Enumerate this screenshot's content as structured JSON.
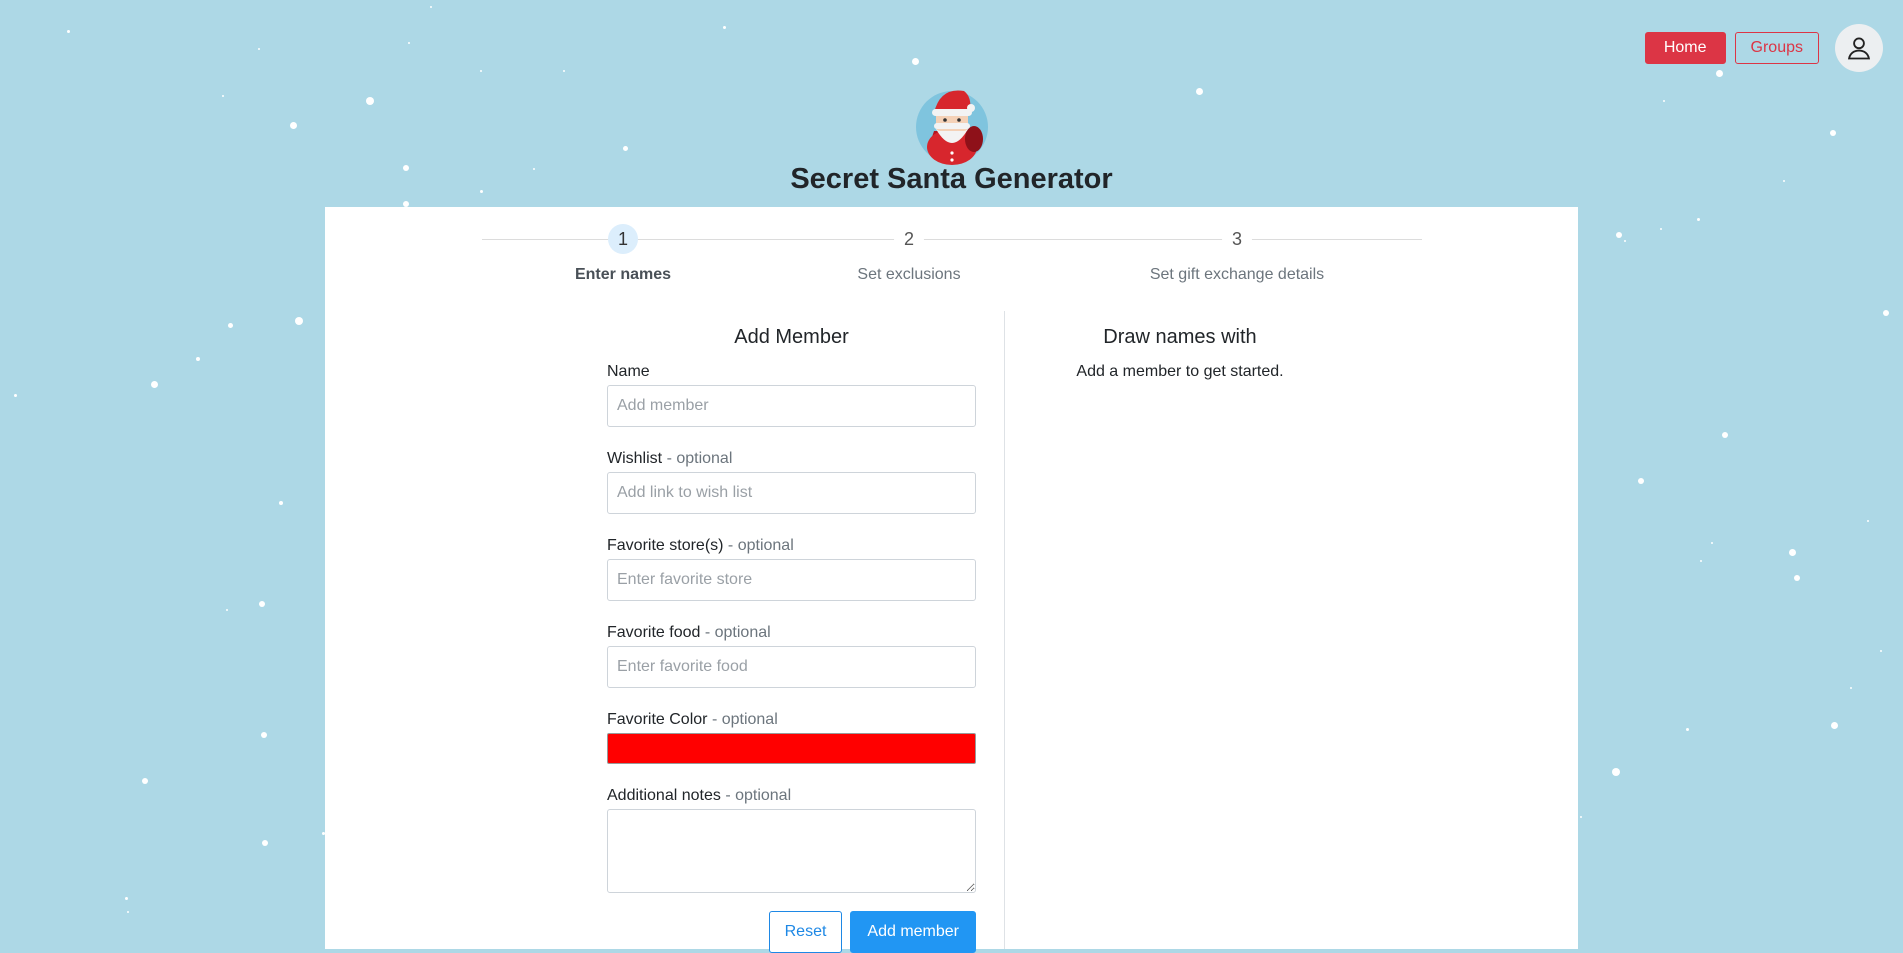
{
  "nav": {
    "home_label": "Home",
    "groups_label": "Groups",
    "account_icon": "person-icon"
  },
  "app": {
    "title": "Secret Santa Generator",
    "logo_icon": "santa-icon"
  },
  "stepper": {
    "steps": [
      {
        "number": "1",
        "label": "Enter names",
        "active": true
      },
      {
        "number": "2",
        "label": "Set exclusions",
        "active": false
      },
      {
        "number": "3",
        "label": "Set gift exchange details",
        "active": false
      }
    ]
  },
  "form": {
    "heading": "Add Member",
    "name": {
      "label": "Name",
      "placeholder": "Add member",
      "value": ""
    },
    "wishlist": {
      "label": "Wishlist",
      "optional": "- optional",
      "placeholder": "Add link to wish list",
      "value": ""
    },
    "stores": {
      "label": "Favorite store(s)",
      "optional": "- optional",
      "placeholder": "Enter favorite store",
      "value": ""
    },
    "food": {
      "label": "Favorite food",
      "optional": "- optional",
      "placeholder": "Enter favorite food",
      "value": ""
    },
    "color": {
      "label": "Favorite Color",
      "optional": "- optional",
      "value": "#ff0000"
    },
    "notes": {
      "label": "Additional notes",
      "optional": "- optional",
      "value": ""
    },
    "reset_label": "Reset",
    "add_label": "Add member"
  },
  "members": {
    "heading": "Draw names with",
    "empty_text": "Add a member to get started."
  },
  "theme": {
    "background": "#add8e6",
    "brand_red": "#dc3545",
    "primary_blue": "#2196f3"
  }
}
